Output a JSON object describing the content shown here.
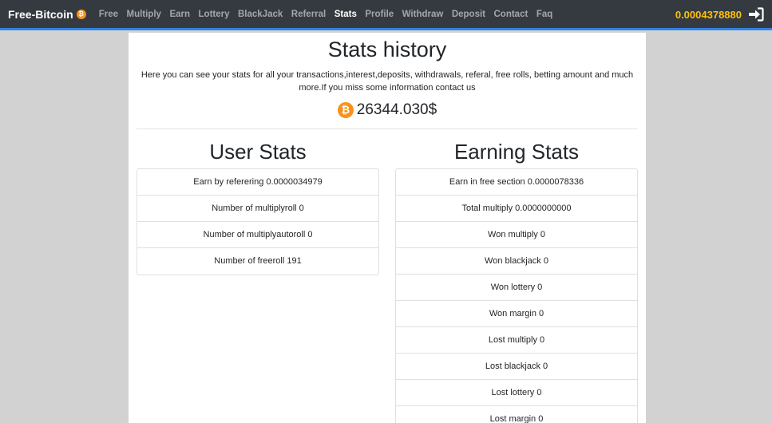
{
  "brand": {
    "name": "Free-Bitcoin",
    "coin_symbol": "₿"
  },
  "nav": [
    {
      "label": "Free",
      "active": false
    },
    {
      "label": "Multiply",
      "active": false
    },
    {
      "label": "Earn",
      "active": false
    },
    {
      "label": "Lottery",
      "active": false
    },
    {
      "label": "BlackJack",
      "active": false
    },
    {
      "label": "Referral",
      "active": false
    },
    {
      "label": "Stats",
      "active": true
    },
    {
      "label": "Profile",
      "active": false
    },
    {
      "label": "Withdraw",
      "active": false
    },
    {
      "label": "Deposit",
      "active": false
    },
    {
      "label": "Contact",
      "active": false
    },
    {
      "label": "Faq",
      "active": false
    }
  ],
  "header": {
    "balance": "0.0004378880",
    "login_icon": "sign-in-icon"
  },
  "page": {
    "title": "Stats history",
    "description": "Here you can see your stats for all your transactions,interest,deposits, withdrawals, referal, free rolls, betting amount and much more.If you miss some information contact us",
    "total_value": "26344.030$",
    "coin_symbol": "₿"
  },
  "user_stats": {
    "heading": "User Stats",
    "items": [
      "Earn by referering 0.0000034979",
      "Number of multiplyroll 0",
      "Number of multiplyautoroll 0",
      "Number of freeroll 191"
    ]
  },
  "earning_stats": {
    "heading": "Earning Stats",
    "items": [
      "Earn in free section 0.0000078336",
      "Total multiply 0.0000000000",
      "Won multiply 0",
      "Won blackjack 0",
      "Won lottery 0",
      "Won margin 0",
      "Lost multiply 0",
      "Lost blackjack 0",
      "Lost lottery 0",
      "Lost margin 0"
    ]
  },
  "colors": {
    "navbar": "#343a40",
    "accent": "#2f83e4",
    "balance": "#ffc107",
    "coin": "#f7931a"
  }
}
